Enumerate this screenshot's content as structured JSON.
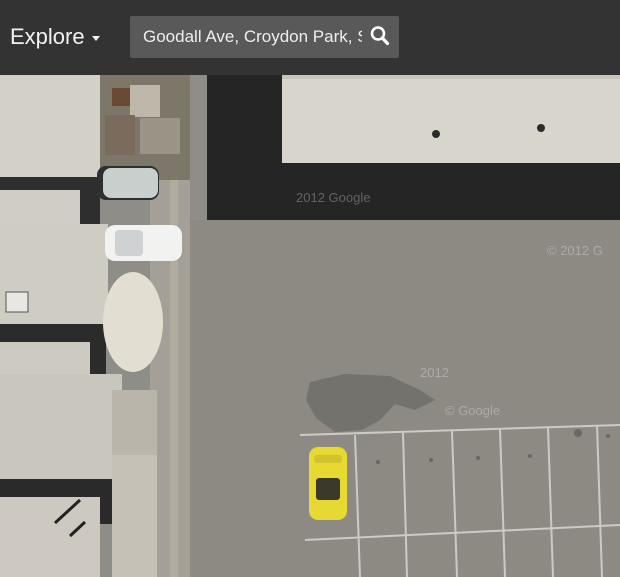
{
  "header": {
    "explore_label": "Explore",
    "explore_caret_icon": "caret-down-icon",
    "search": {
      "value": "Goodall Ave, Croydon Park, S",
      "icon": "search-icon"
    }
  },
  "map": {
    "view": "satellite",
    "watermarks": [
      "2012 Google",
      "© 2012 G",
      "2012",
      "© Google"
    ]
  },
  "colors": {
    "header_bg": "#333333",
    "search_bg": "#595959",
    "car_yellow": "#e8d832"
  }
}
